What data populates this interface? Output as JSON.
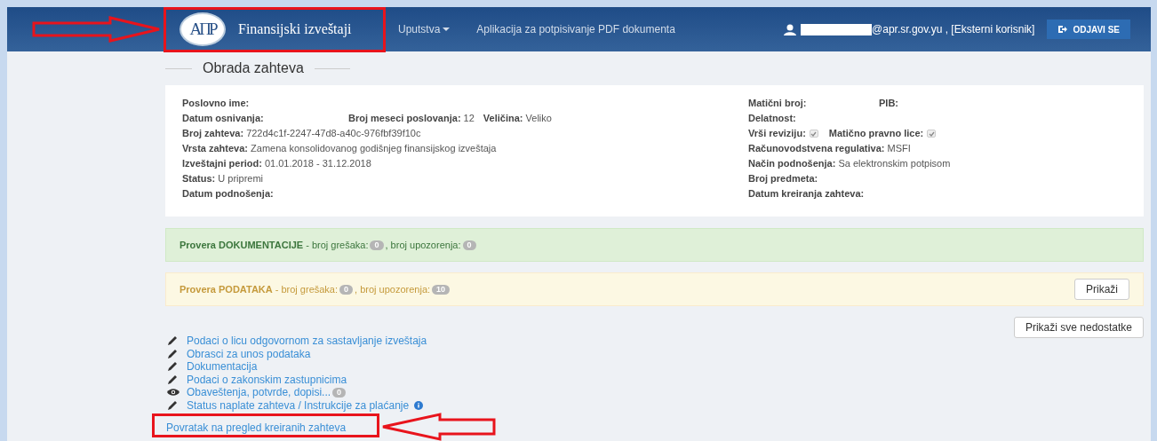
{
  "navbar": {
    "logo_text": "AПР",
    "brand": "Finansijski izveštaji",
    "menu": [
      {
        "label": "Uputstva",
        "kind": "dropdown"
      },
      {
        "label": "Aplikacija za potpisivanje PDF dokumenta",
        "kind": "link"
      }
    ],
    "user": "@apr.sr.gov.yu , [Eksterni korisnik]",
    "logout": "ODJAVI SE"
  },
  "section_title": "Obrada zahteva",
  "details_left": [
    [
      {
        "label": "Poslovno ime:"
      }
    ],
    [
      {
        "label": "Datum osnivanja:"
      },
      {
        "label": "Broj meseci poslovanja:",
        "value": "12"
      },
      {
        "label": "Veličina:",
        "value": "Veliko"
      }
    ],
    [
      {
        "label": "Broj zahteva:",
        "value": "722d4c1f-2247-47d8-a40c-976fbf39f10c"
      }
    ],
    [
      {
        "label": "Vrsta zahteva:",
        "value": "Zamena konsolidovanog godišnjeg finansijskog izveštaja"
      }
    ],
    [
      {
        "label": "Izveštajni period:",
        "value": "01.01.2018 - 31.12.2018"
      }
    ],
    [
      {
        "label": "Status:",
        "value": "U pripremi"
      }
    ],
    [
      {
        "label": "Datum podnošenja:"
      }
    ]
  ],
  "details_right": [
    [
      {
        "label": "Matični broj:"
      },
      {
        "label": "PIB:"
      }
    ],
    [
      {
        "label": "Delatnost:"
      }
    ],
    [
      {
        "label": "Vrši reviziju:",
        "checked": true
      },
      {
        "label": "Matično pravno lice:",
        "checked": true
      }
    ],
    [
      {
        "label": "Računovodstvena regulativa:",
        "value": "MSFI"
      }
    ],
    [
      {
        "label": "Način podnošenja:",
        "value": "Sa elektronskim potpisom"
      }
    ],
    [
      {
        "label": "Broj predmeta:"
      }
    ],
    [
      {
        "label": "Datum kreiranja zahteva:"
      }
    ]
  ],
  "checks": [
    {
      "kind": "success",
      "title": "Provera DOKUMENTACIJE",
      "errors_label": "- broj grešaka:",
      "errors": "0",
      "warnings_label": ", broj upozorenja:",
      "warnings": "0"
    },
    {
      "kind": "warning",
      "title": "Provera PODATAKA",
      "errors_label": "- broj grešaka:",
      "errors": "0",
      "warnings_label": ", broj upozorenja:",
      "warnings": "10",
      "button": "Prikaži"
    }
  ],
  "show_all_button": "Prikaži sve nedostatke",
  "links": [
    {
      "kind": "pencil",
      "label": "Podaci o licu odgovornom za sastavljanje izveštaja"
    },
    {
      "kind": "pencil",
      "label": "Obrasci za unos podataka"
    },
    {
      "kind": "pencil",
      "label": "Dokumentacija"
    },
    {
      "kind": "pencil",
      "label": "Podaci o zakonskim zastupnicima"
    },
    {
      "kind": "eye",
      "label": "Obaveštenja, potvrde, dopisi...",
      "badge": "0"
    },
    {
      "kind": "pencil",
      "label": "Status naplate zahteva / Instrukcije za plaćanje",
      "info": true
    }
  ],
  "back_link": "Povratak na pregled kreiranih zahteva"
}
